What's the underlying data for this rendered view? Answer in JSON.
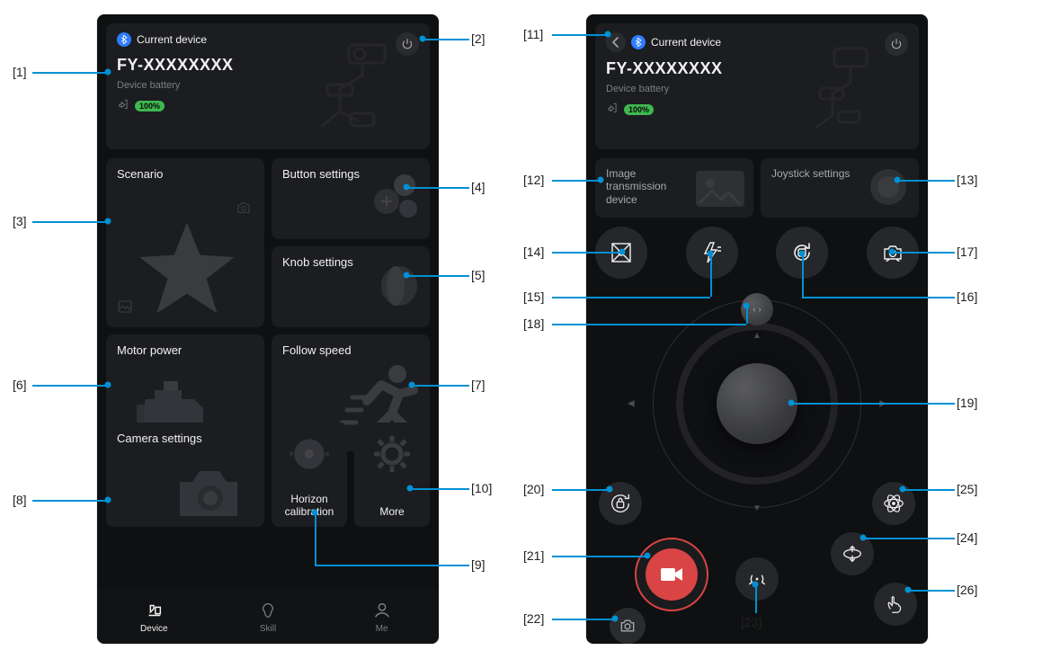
{
  "header": {
    "bt_label": "Current device",
    "device_name": "FY-XXXXXXXX",
    "battery_label": "Device battery",
    "battery_pct": "100%"
  },
  "left_tiles": {
    "scenario": "Scenario",
    "button_settings": "Button settings",
    "knob_settings": "Knob settings",
    "motor_power": "Motor power",
    "follow_speed": "Follow speed",
    "camera_settings": "Camera settings",
    "horizon_calibration": "Horizon calibration",
    "more": "More"
  },
  "tabs": {
    "device": "Device",
    "skill": "Skill",
    "me": "Me"
  },
  "right_tiles": {
    "image_transmission": "Image transmission device",
    "joystick_settings": "Joystick settings"
  },
  "callouts": {
    "c1": "[1]",
    "c2": "[2]",
    "c3": "[3]",
    "c4": "[4]",
    "c5": "[5]",
    "c6": "[6]",
    "c7": "[7]",
    "c8": "[8]",
    "c9": "[9]",
    "c10": "[10]",
    "c11": "[11]",
    "c12": "[12]",
    "c13": "[13]",
    "c14": "[14]",
    "c15": "[15]",
    "c16": "[16]",
    "c17": "[17]",
    "c18": "[18]",
    "c19": "[19]",
    "c20": "[20]",
    "c21": "[21]",
    "c22": "[22]",
    "c23": "[23]",
    "c24": "[24]",
    "c25": "[25]",
    "c26": "[26]"
  }
}
